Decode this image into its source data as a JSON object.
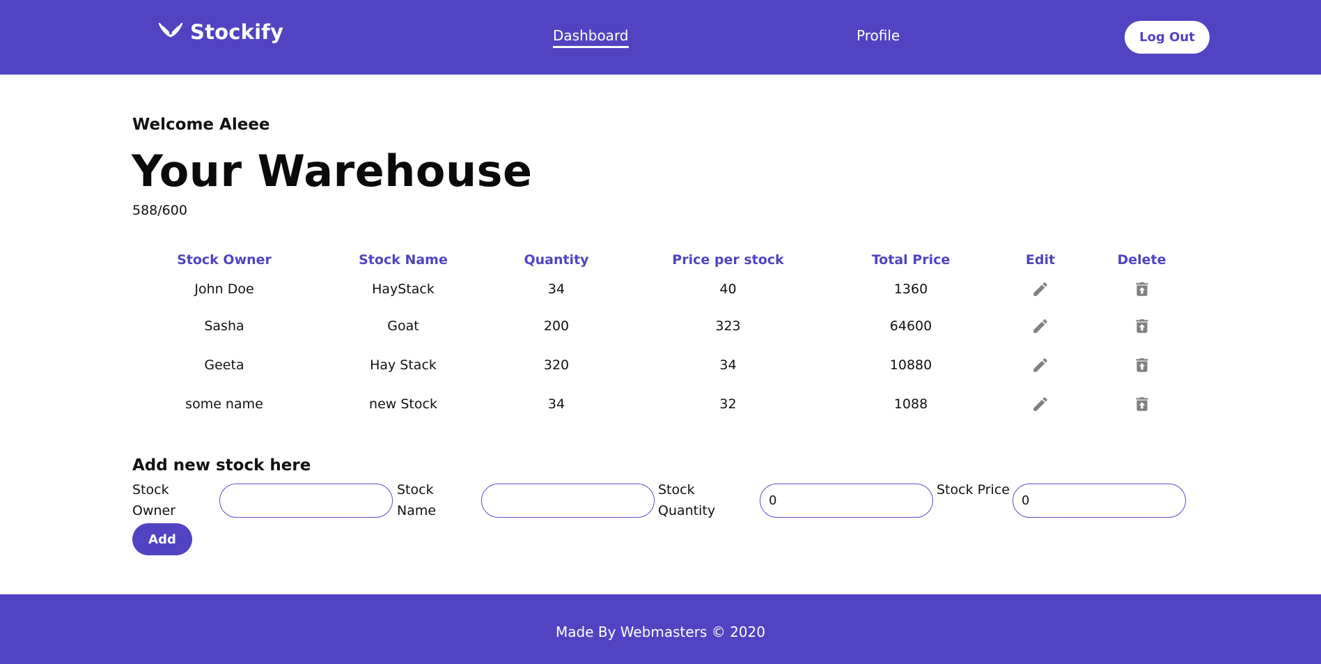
{
  "header": {
    "brand": "Stockify",
    "logo_icon": "wings-logo-icon",
    "nav": {
      "dashboard": "Dashboard",
      "profile": "Profile"
    },
    "active_nav": "Dashboard",
    "logout_label": "Log Out"
  },
  "main": {
    "welcome": "Welcome Aleee",
    "title": "Your Warehouse",
    "capacity": "588/600"
  },
  "table": {
    "headers": [
      "Stock Owner",
      "Stock Name",
      "Quantity",
      "Price per stock",
      "Total Price",
      "Edit",
      "Delete"
    ],
    "rows": [
      [
        "John Doe",
        "HayStack",
        "34",
        "40",
        "1360"
      ],
      [
        "Sasha",
        "Goat",
        "200",
        "323",
        "64600"
      ],
      [
        "Geeta",
        "Hay Stack",
        "320",
        "34",
        "10880"
      ],
      [
        "some name",
        "new Stock",
        "34",
        "32",
        "1088"
      ]
    ],
    "edit_icon": "pencil-icon",
    "delete_icon": "trash-icon"
  },
  "form": {
    "title": "Add new stock here",
    "owner_label": "Stock Owner",
    "owner_value": "",
    "name_label": "Stock Name",
    "name_value": "",
    "qty_label": "Stock Quantity",
    "qty_value": "0",
    "price_label": "Stock Price",
    "price_value": "0",
    "add_label": "Add"
  },
  "footer": {
    "text": "Made By Webmasters © 2020"
  },
  "colors": {
    "brand": "#5243c2",
    "icon": "#808080"
  }
}
